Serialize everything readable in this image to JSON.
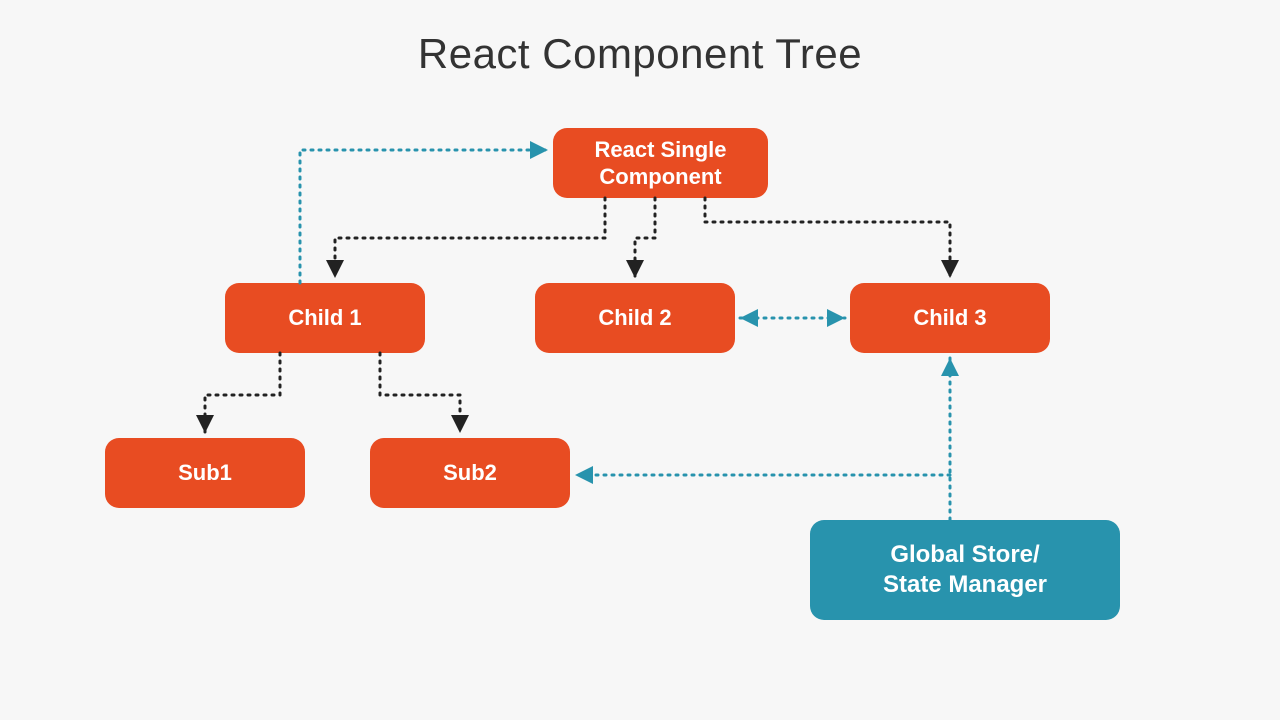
{
  "title": "React Component Tree",
  "nodes": {
    "root": {
      "label": "React Single Component",
      "color": "orange"
    },
    "child1": {
      "label": "Child 1",
      "color": "orange"
    },
    "child2": {
      "label": "Child 2",
      "color": "orange"
    },
    "child3": {
      "label": "Child 3",
      "color": "orange"
    },
    "sub1": {
      "label": "Sub1",
      "color": "orange"
    },
    "sub2": {
      "label": "Sub2",
      "color": "orange"
    },
    "store": {
      "label": "Global Store/\nState Manager",
      "color": "teal"
    }
  },
  "edges": [
    {
      "from": "root",
      "to": "child1",
      "style": "black",
      "direction": "down"
    },
    {
      "from": "root",
      "to": "child2",
      "style": "black",
      "direction": "down"
    },
    {
      "from": "root",
      "to": "child3",
      "style": "black",
      "direction": "down"
    },
    {
      "from": "child1",
      "to": "sub1",
      "style": "black",
      "direction": "down"
    },
    {
      "from": "child1",
      "to": "sub2",
      "style": "black",
      "direction": "down"
    },
    {
      "from": "child1",
      "to": "root",
      "style": "teal",
      "direction": "up-loop"
    },
    {
      "from": "child2",
      "to": "child3",
      "style": "teal",
      "direction": "bidirectional"
    },
    {
      "from": "store",
      "to": "child3",
      "style": "teal",
      "direction": "up"
    },
    {
      "from": "store",
      "to": "sub2",
      "style": "teal",
      "direction": "left"
    }
  ]
}
